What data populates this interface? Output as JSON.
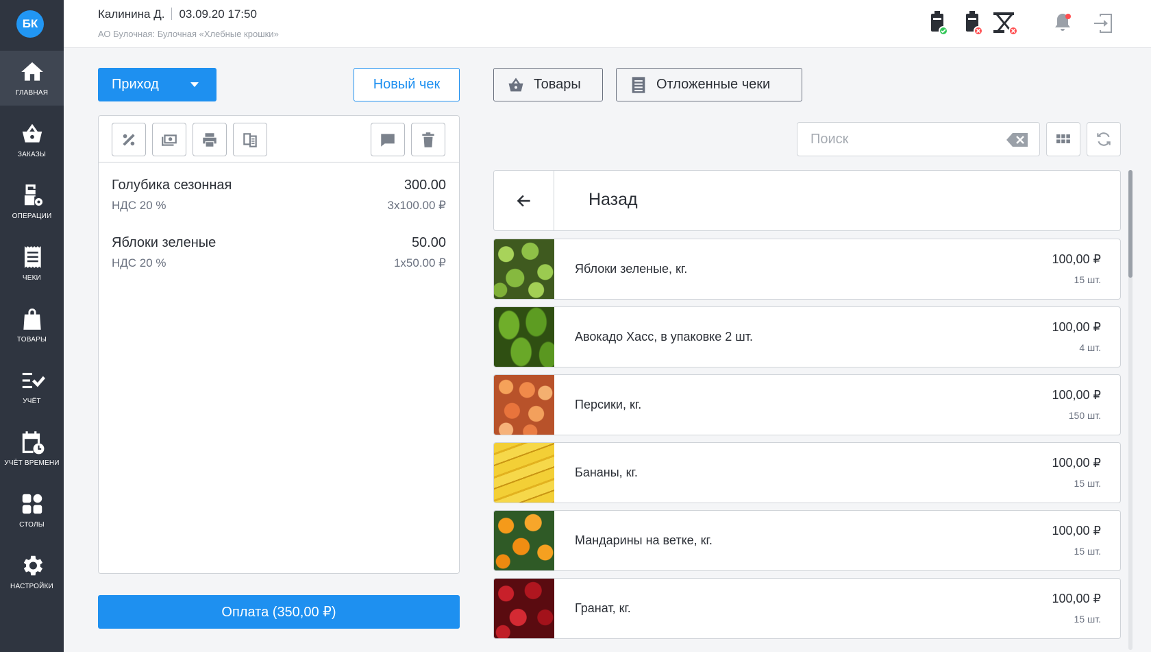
{
  "app": {
    "logo": "БК"
  },
  "sidebar": {
    "items": [
      {
        "label": "ГЛАВНАЯ",
        "icon": "home-icon",
        "active": true
      },
      {
        "label": "ЗАКАЗЫ",
        "icon": "basket-icon"
      },
      {
        "label": "ОПЕРАЦИИ",
        "icon": "cash-register-settings-icon"
      },
      {
        "label": "ЧЕКИ",
        "icon": "receipt-icon"
      },
      {
        "label": "ТОВАРЫ",
        "icon": "shopping-bag-icon"
      },
      {
        "label": "УЧЁТ",
        "icon": "checklist-icon"
      },
      {
        "label": "УЧЁТ ВРЕМЕНИ",
        "icon": "calendar-clock-icon"
      },
      {
        "label": "СТОЛЫ",
        "icon": "tables-grid-icon"
      },
      {
        "label": "НАСТРОЙКИ",
        "icon": "gear-icon"
      }
    ]
  },
  "header": {
    "user": "Калинина Д.",
    "datetime": "03.09.20 17:50",
    "org": "АО Булочная: Булочная «Хлебные крошки»",
    "icons": [
      "fiscal-printer-ok-icon",
      "fiscal-printer-error-icon",
      "scanner-error-icon",
      "bell-icon",
      "logout-icon"
    ],
    "colors": {
      "ok": "#34c759",
      "error": "#ff4d4f"
    }
  },
  "actions": {
    "operation_label": "Приход",
    "new_receipt_label": "Новый чек",
    "goods_tab_label": "Товары",
    "deferred_tab_label": "Отложенные чеки"
  },
  "receipt": {
    "toolbar": [
      "percent-icon",
      "cash-icon",
      "printer-icon",
      "copy-receipt-icon",
      "comment-icon",
      "trash-icon"
    ],
    "items": [
      {
        "name": "Голубика сезонная",
        "tax": "НДС 20 %",
        "sum": "300.00",
        "qty": "3x100.00 ₽"
      },
      {
        "name": "Яблоки зеленые",
        "tax": "НДС 20 %",
        "sum": "50.00",
        "qty": "1x50.00 ₽"
      }
    ],
    "pay_label": "Оплата (350,00 ₽)"
  },
  "catalog": {
    "search_placeholder": "Поиск",
    "back_label": "Назад",
    "products": [
      {
        "name": "Яблоки зеленые, кг.",
        "price": "100,00 ₽",
        "qty": "15 шт.",
        "kind": "apples"
      },
      {
        "name": "Авокадо Хасс, в упаковке 2 шт.",
        "price": "100,00 ₽",
        "qty": "4 шт.",
        "kind": "avocado"
      },
      {
        "name": "Персики, кг.",
        "price": "100,00 ₽",
        "qty": "150 шт.",
        "kind": "peaches"
      },
      {
        "name": "Бананы, кг.",
        "price": "100,00 ₽",
        "qty": "15 шт.",
        "kind": "bananas"
      },
      {
        "name": "Мандарины на ветке, кг.",
        "price": "100,00 ₽",
        "qty": "15 шт.",
        "kind": "mandarins"
      },
      {
        "name": "Гранат, кг.",
        "price": "100,00 ₽",
        "qty": "15 шт.",
        "kind": "pomegranate"
      }
    ]
  },
  "theme": {
    "accent": "#1e90f0",
    "sidebar_bg": "#2f3540"
  }
}
